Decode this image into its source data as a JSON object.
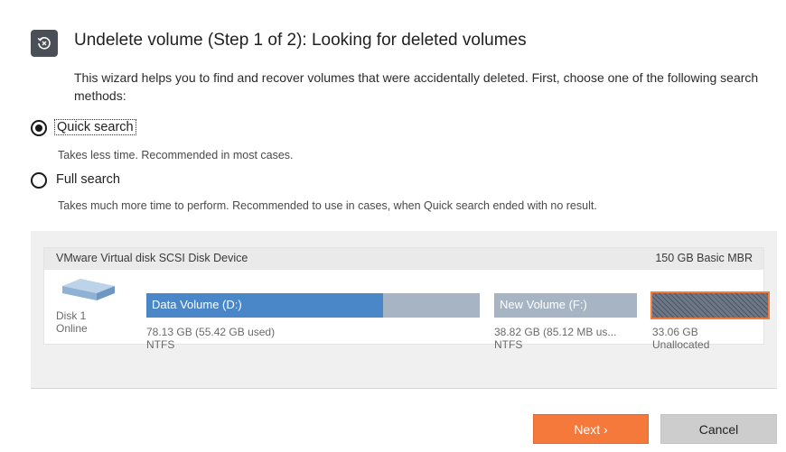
{
  "dialog": {
    "title": "Undelete volume (Step 1 of 2): Looking for deleted volumes",
    "title_icon": "undelete-restore-icon",
    "intro": "This wizard helps you to find and recover volumes that were accidentally deleted. First, choose one of the following search methods:"
  },
  "options": [
    {
      "label": "Quick search",
      "description": "Takes less time. Recommended in most cases.",
      "selected": true
    },
    {
      "label": "Full search",
      "description": "Takes much more time to perform. Recommended to use in cases, when Quick search ended with no result.",
      "selected": false
    }
  ],
  "disk": {
    "name": "VMware Virtual disk SCSI Disk Device",
    "size_type": "150 GB Basic MBR",
    "icon": "hard-disk-icon",
    "label": "Disk 1",
    "status": "Online",
    "partitions": [
      {
        "name": "Data Volume (D:)",
        "size_info": "78.13 GB (55.42 GB used)",
        "fs": "NTFS",
        "used_fraction": 0.71,
        "color": "#4a87c9",
        "track_color": "#a7b4c4"
      },
      {
        "name": "New Volume (F:)",
        "size_info": "38.82 GB (85.12 MB us...",
        "fs": "NTFS",
        "used_fraction": 0.0,
        "color": "#4a87c9",
        "track_color": "#a7b4c4"
      }
    ],
    "unallocated": {
      "size": "33.06 GB",
      "label": "Unallocated",
      "border_color": "#f07b3a"
    }
  },
  "buttons": {
    "next": "Next ›",
    "cancel": "Cancel"
  },
  "colors": {
    "accent": "#f5793b",
    "volume_blue": "#4a87c9",
    "volume_track": "#a7b4c4"
  }
}
